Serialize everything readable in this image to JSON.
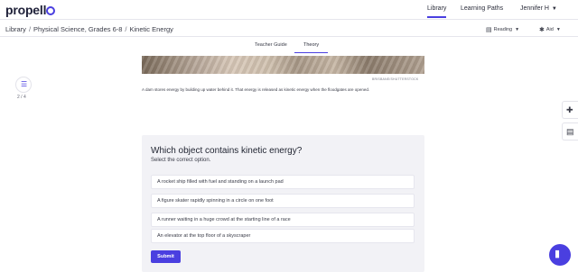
{
  "header": {
    "logo": "propell",
    "nav": [
      {
        "label": "Library"
      },
      {
        "label": "Learning Paths"
      }
    ],
    "user": "Jennifer H"
  },
  "breadcrumb": {
    "items": [
      "Library",
      "Physical Science, Grades 6-8",
      "Kinetic Energy"
    ]
  },
  "toolbar": {
    "reading": "Reading",
    "aid": "Aid"
  },
  "subtabs": [
    {
      "label": "Teacher Guide"
    },
    {
      "label": "Theory"
    }
  ],
  "progress": {
    "label": "2 / 4"
  },
  "content": {
    "credit": "BRISBANE/SHUTTERSTOCK",
    "caption": "A dam stores energy by building up water behind it. That energy is released as kinetic energy when the floodgates are opened."
  },
  "quiz": {
    "question": "Which object contains kinetic energy?",
    "instruction": "Select the correct option.",
    "options": [
      "A rocket ship filled with fuel and standing on a launch pad",
      "A figure skater rapidly spinning in a circle on one foot",
      "A runner waiting in a huge crowd at the starting line of a race",
      "An elevator at the top floor of a skyscraper"
    ],
    "submit": "Submit"
  },
  "accent_color": "#4a3fe0"
}
